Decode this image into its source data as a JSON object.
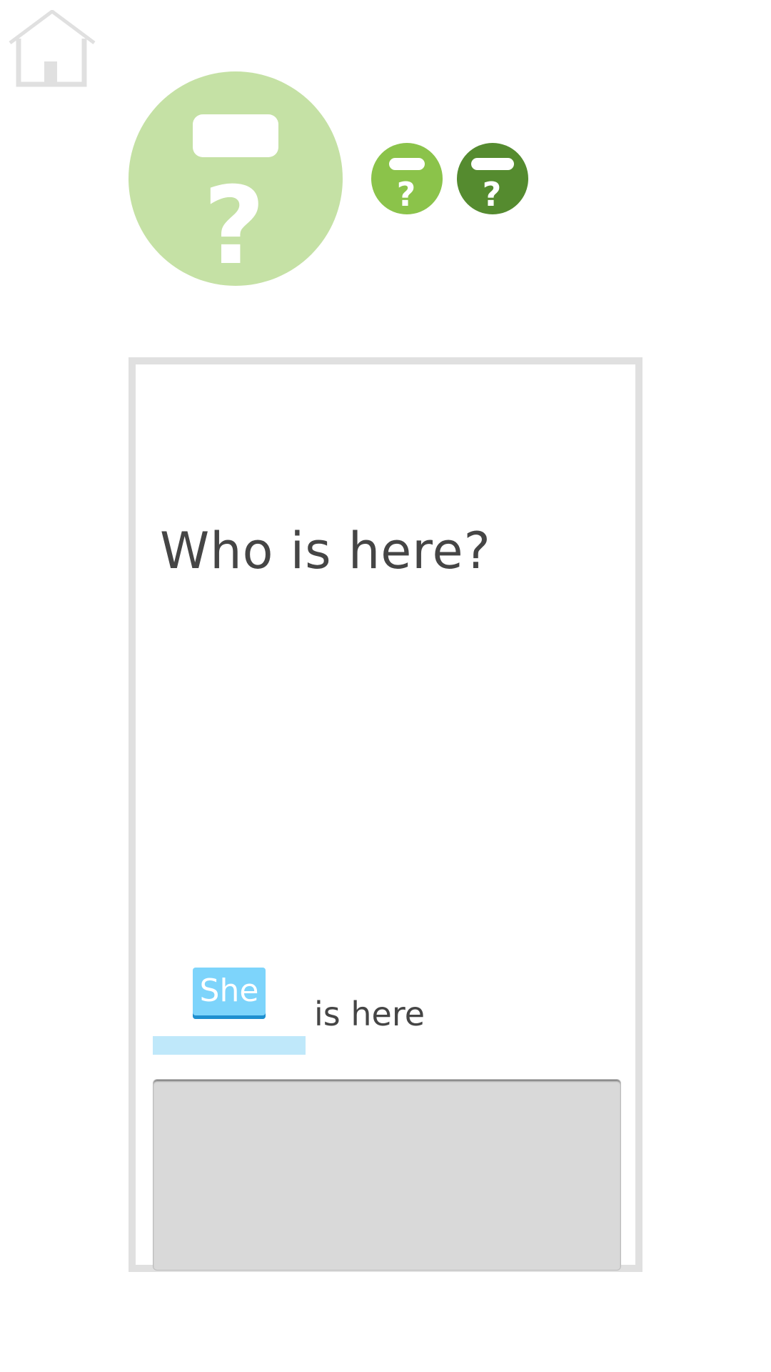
{
  "nav": {
    "home_icon": "home-icon"
  },
  "progress": {
    "big_badge_icon": "question-icon",
    "items": [
      {
        "icon": "question-icon",
        "color": "#8bc34a"
      },
      {
        "icon": "question-icon",
        "color": "#558b2f"
      }
    ],
    "big_color": "#c5e1a5"
  },
  "exercise": {
    "question": "Who is here?",
    "placed_word": "She",
    "sentence_rest": "is here"
  },
  "colors": {
    "tile": "#7dd4fb",
    "tile_shadow": "#1e8fcf",
    "slot": "#bfe8fa",
    "card_border": "#e0e0e0",
    "tray": "#d9d9d9"
  }
}
